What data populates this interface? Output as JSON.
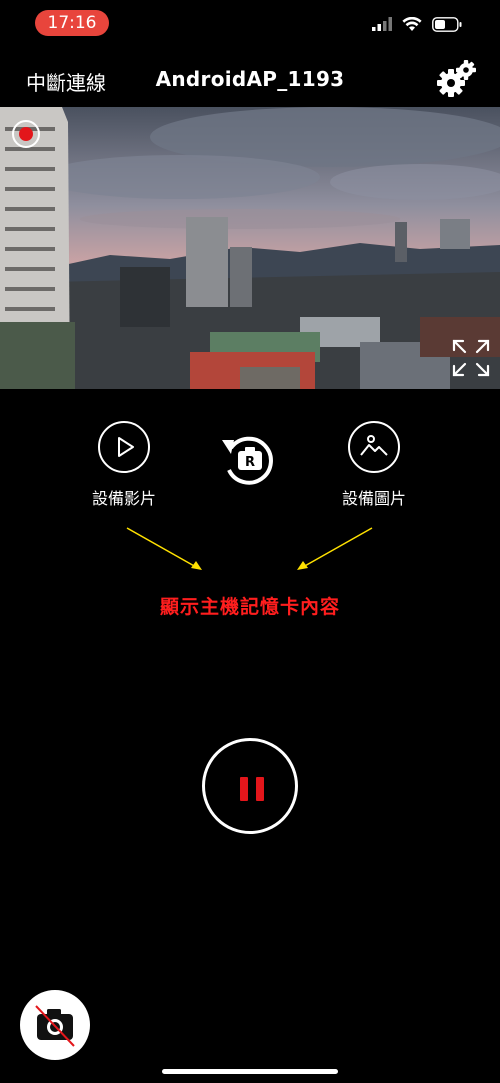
{
  "status_bar": {
    "time": "17:16"
  },
  "header": {
    "disconnect_label": "中斷連線",
    "title": "AndroidAP_1193"
  },
  "controls": {
    "device_video_label": "設備影片",
    "device_photo_label": "設備圖片",
    "hint_text": "顯示主機記憶卡內容"
  },
  "colors": {
    "accent_red": "#e3161b",
    "time_pill": "#e8453c",
    "hint_red": "#ff1e1e",
    "arrow_yellow": "#ffe100"
  },
  "icons": [
    "signal-icon",
    "wifi-icon",
    "battery-icon",
    "gear-icon",
    "record-indicator-icon",
    "expand-icon",
    "play-icon",
    "rotate-camera-icon",
    "image-icon",
    "pause-icon",
    "camera-off-icon"
  ]
}
